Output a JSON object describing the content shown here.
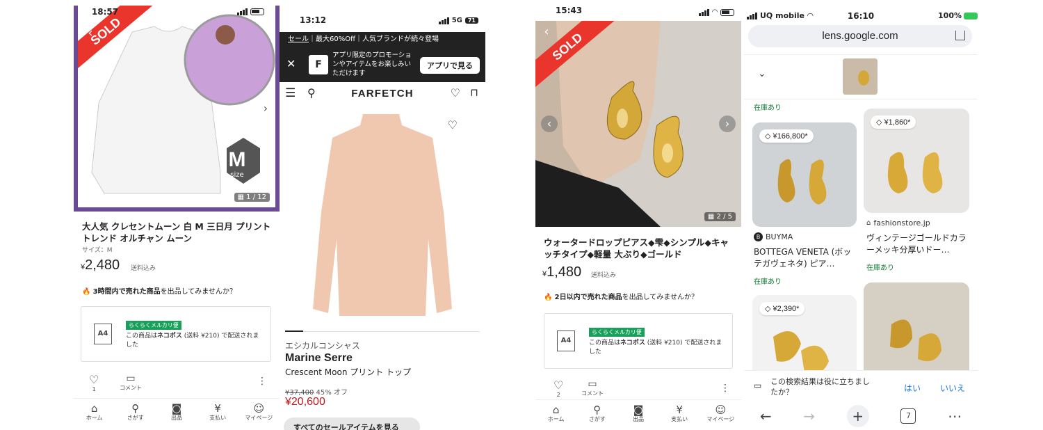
{
  "colors": {
    "sold_red": "#ea352d",
    "mercari_green": "#19a05a",
    "farfetch_black": "#222222",
    "sale_red": "#c0141a",
    "lens_green": "#188038",
    "purple_frame": "#6a4c93"
  },
  "phone1": {
    "status": {
      "time": "18:57"
    },
    "sold_label": "SOLD",
    "size_badge": {
      "letter": "M",
      "word": "size"
    },
    "image_counter": "1 / 12",
    "title": "大人気 クレセントムーン 白 M 三日月 プリント トレンド オルチャン ムーン",
    "size_label": "サイズ：M",
    "price_symbol": "¥",
    "price": "2,480",
    "shipping_included": "送料込み",
    "promo": {
      "bold": "3時間内で売れた商品",
      "text": "を出品してみませんか？"
    },
    "shipbox": {
      "icon": "A4",
      "badge": "らくらくメルカリ便",
      "line1": "この商品は",
      "method": "ネコポス",
      "line2": " (送料 ¥210) で配送されました"
    },
    "likes": "1",
    "comment_label": "コメント",
    "tabs": [
      {
        "icon": "home-icon",
        "label": "ホーム"
      },
      {
        "icon": "search-icon",
        "label": "さがす"
      },
      {
        "icon": "camera-icon",
        "label": "出品"
      },
      {
        "icon": "yen-icon",
        "label": "支払い"
      },
      {
        "icon": "person-icon",
        "label": "マイページ"
      }
    ]
  },
  "phone2": {
    "status": {
      "time": "13:12",
      "network": "5G",
      "battery": "71"
    },
    "banner": {
      "link": "セール",
      "text": "｜最大60%Off｜人気ブランドが続々登場"
    },
    "app_promo": {
      "logo": "F",
      "text": "アプリ限定のプロモーションやアイテムをお楽しみいただけます",
      "button": "アプリで見る"
    },
    "brand_logo": "FARFETCH",
    "category": "エシカルコンシャス",
    "brand": "Marine Serre",
    "product_name": "Crescent Moon プリント トップ",
    "old_price": "¥37,400",
    "discount": "45% オフ",
    "new_price": "¥20,600",
    "all_button": "すべてのセールアイテムを見る"
  },
  "phone3": {
    "status": {
      "time": "15:43"
    },
    "sold_label": "SOLD",
    "image_counter": "2 / 5",
    "title": "ウォータードロップピアス◆雫◆シンプル◆キャッチタイプ◆軽量 大ぶり◆ゴールド",
    "price_symbol": "¥",
    "price": "1,480",
    "shipping_included": "送料込み",
    "promo": {
      "bold": "2日以内で売れた商品",
      "text": "を出品してみませんか？"
    },
    "shipbox": {
      "icon": "A4",
      "badge": "らくらくメルカリ便",
      "line1": "この商品は",
      "method": "ネコポス",
      "line2": " (送料 ¥210) で配送されました"
    },
    "likes": "2",
    "comment_label": "コメント",
    "tabs": [
      {
        "icon": "home-icon",
        "label": "ホーム"
      },
      {
        "icon": "search-icon",
        "label": "さがす"
      },
      {
        "icon": "camera-icon",
        "label": "出品"
      },
      {
        "icon": "yen-icon",
        "label": "支払い"
      },
      {
        "icon": "person-icon",
        "label": "マイページ"
      }
    ]
  },
  "phone4": {
    "status": {
      "carrier": "UQ mobile",
      "time": "16:10",
      "battery": "100%"
    },
    "url": "lens.google.com",
    "top_stock": "在庫あり",
    "results": [
      {
        "price": "¥166,800*",
        "site": "BUYMA",
        "title": "BOTTEGA VENETA (ボッテガヴェネタ) ピア…",
        "stock": "在庫あり"
      },
      {
        "price": "¥1,860*",
        "site": "fashionstore.jp",
        "title": "ヴィンテージゴールドカラーメッキ分厚いドー…",
        "stock": "在庫あり"
      },
      {
        "price": "¥2,390*"
      }
    ],
    "feedback": {
      "question": "この検索結果は役に立ちましたか？",
      "yes": "はい",
      "no": "いいえ"
    },
    "tab_count": "7"
  }
}
